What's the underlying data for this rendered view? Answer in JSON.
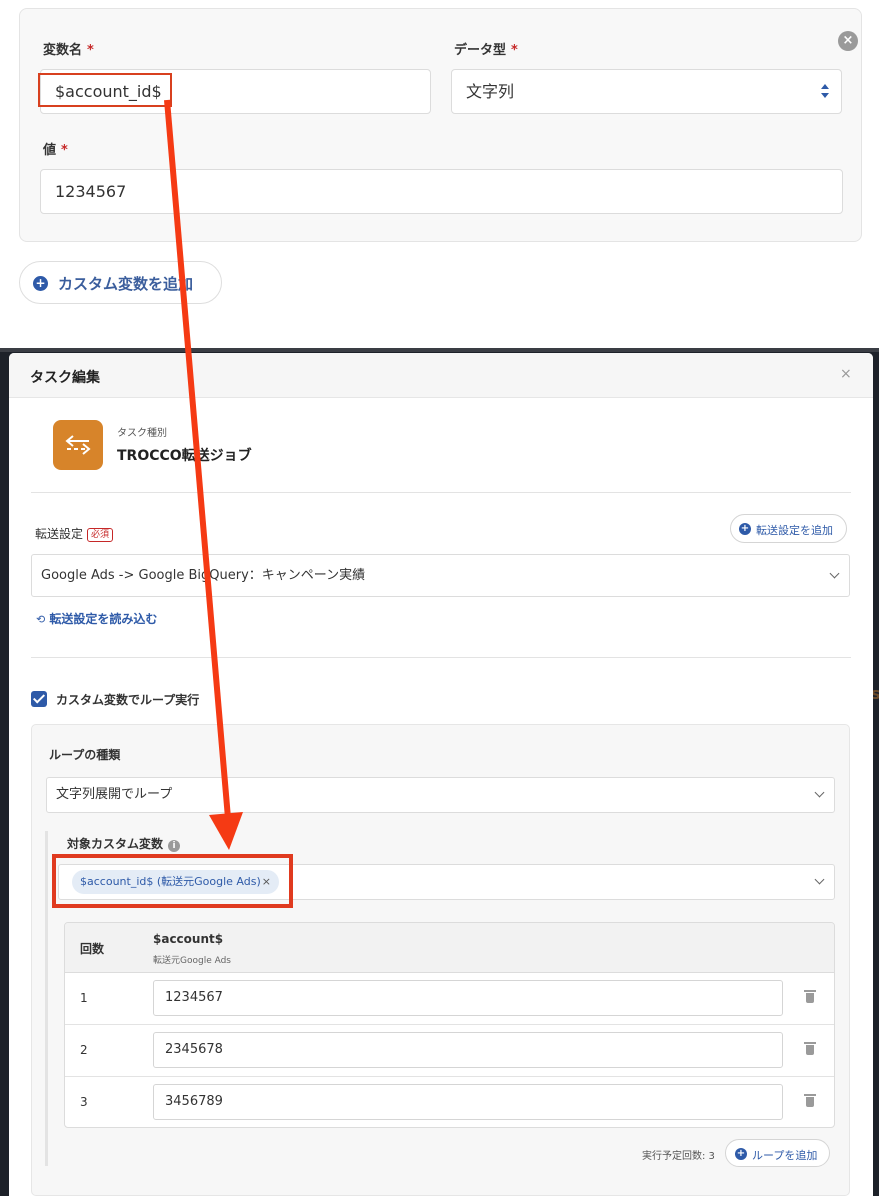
{
  "variable_form": {
    "name_label": "変数名",
    "name_value": "$account_id$",
    "type_label": "データ型",
    "type_value": "文字列",
    "value_label": "値",
    "value_value": "1234567",
    "required_mark": "*",
    "close_icon": "close-circle-icon",
    "add_button_label": "カスタム変数を追加"
  },
  "modal": {
    "title": "タスク編集",
    "close_glyph": "×",
    "task_type_label": "タスク種別",
    "task_type_value": "TROCCO転送ジョブ",
    "transfer_label": "転送設定",
    "required_badge": "必須",
    "add_transfer_button": "転送設定を追加",
    "transfer_select_value": "Google Ads -> Google BigQuery：キャンペーン実績",
    "reload_link": "転送設定を読み込む",
    "loop_checkbox_label": "カスタム変数でループ実行",
    "loop_checked": true,
    "loop_type_label": "ループの種類",
    "loop_type_value": "文字列展開でループ",
    "target_var_label": "対象カスタム変数",
    "target_var_chip": "$account_id$ (転送元Google Ads)",
    "chip_remove_glyph": "×",
    "table": {
      "col_count": "回数",
      "col_var": "$account$",
      "col_var_sub": "転送元Google Ads",
      "rows": [
        {
          "num": "1",
          "value": "1234567"
        },
        {
          "num": "2",
          "value": "2345678"
        },
        {
          "num": "3",
          "value": "3456789"
        }
      ]
    },
    "scheduled_count_text": "実行予定回数: 3",
    "add_loop_button": "ループを追加"
  },
  "colors": {
    "accent_blue": "#2e5aa8",
    "highlight_red": "#e03a1f",
    "task_icon_orange": "#d7842a",
    "backdrop": "#1d2129"
  }
}
